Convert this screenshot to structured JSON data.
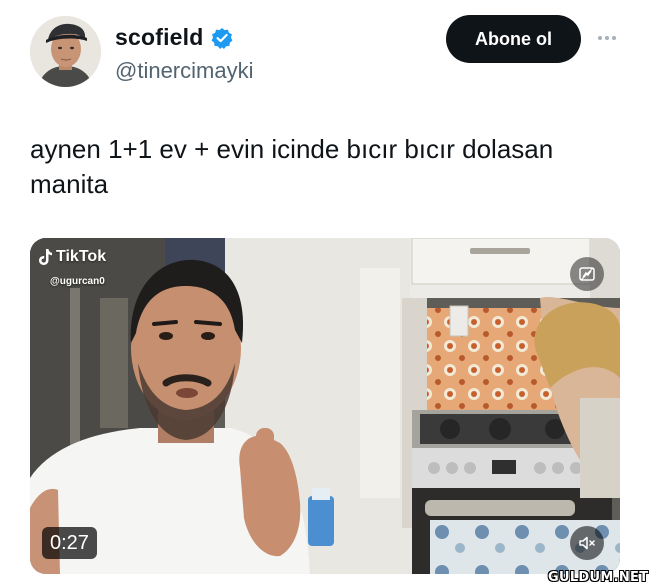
{
  "author": {
    "display_name": "scofield",
    "handle": "@tinercimayki",
    "verified": true,
    "verified_color": "#1d9bf0"
  },
  "follow_button": {
    "label": "Abone ol"
  },
  "more_icon": "more-horizontal-icon",
  "tweet": {
    "text": "aynen 1+1 ev + evin icinde bıcır bıcır dolasan manita"
  },
  "video": {
    "overlay_brand": "TikTok",
    "overlay_user": "@ugurcan0",
    "duration": "0:27",
    "gif_icon": "gif-icon",
    "mute_icon": "volume-muted-icon"
  },
  "watermark": "GULDUM.NET",
  "colors": {
    "text_primary": "#0f1419",
    "text_secondary": "#536471",
    "button_bg": "#0f1419",
    "button_text": "#ffffff"
  }
}
